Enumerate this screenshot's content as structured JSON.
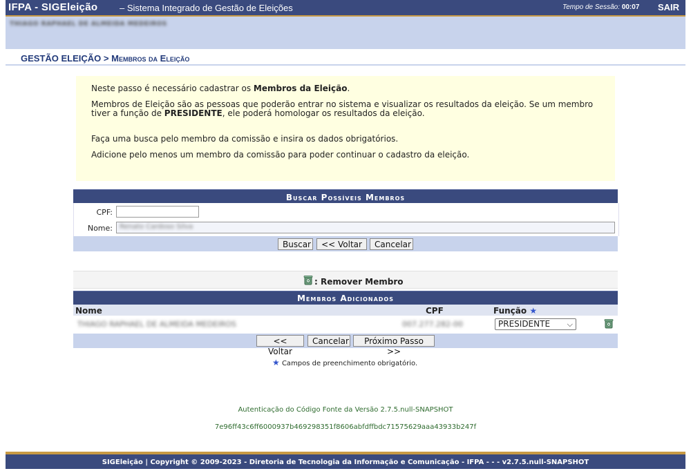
{
  "header": {
    "app_title": "IFPA - SIGEleição",
    "subtitle": "– Sistema Integrado de Gestão de Eleições",
    "session_label": "Tempo de Sessão:",
    "session_time": "00:07",
    "logout": "SAIR"
  },
  "user": {
    "name": "THIAGO RAPHAEL DE ALMEIDA MEDEIROS"
  },
  "breadcrumb": {
    "text": "Gestão Eleição > Membros da Eleição"
  },
  "info": {
    "p1_pre": "Neste passo é necessário cadastrar os ",
    "p1_bold": "Membros da Eleição",
    "p1_post": ".",
    "p2_pre": "Membros de Eleição são as pessoas que poderão entrar no sistema e visualizar os resultados da eleição. Se um membro tiver a função de ",
    "p2_bold": "PRESIDENTE",
    "p2_post": ", ele poderá homologar os resultados da eleição.",
    "p3": "Faça uma busca pelo membro da comissão e insira os dados obrigatórios.",
    "p4": "Adicione pelo menos um membro da comissão para poder continuar o cadastro da eleição."
  },
  "search": {
    "title": "Buscar Possíveis Membros",
    "cpf_label": "CPF:",
    "cpf_value": "",
    "name_label": "Nome:",
    "name_value": "Renato Cardoso Silva",
    "buttons": {
      "search": "Buscar",
      "back": "<< Voltar",
      "cancel": "Cancelar"
    }
  },
  "legend": {
    "remove": ": Remover Membro"
  },
  "members": {
    "title": "Membros Adicionados",
    "columns": {
      "name": "Nome",
      "cpf": "CPF",
      "role": "Função"
    },
    "rows": [
      {
        "name": "THIAGO RAPHAEL DE ALMEIDA MEDEIROS",
        "cpf": "007.277.282-00",
        "role": "PRESIDENTE"
      }
    ],
    "buttons": {
      "back": "<< Voltar",
      "cancel": "Cancelar",
      "next": "Próximo Passo >>"
    }
  },
  "required_note": "Campos de preenchimento obrigatório.",
  "auth": {
    "line1": "Autenticação do Código Fonte da Versão 2.7.5.null-SNAPSHOT",
    "hash": "7e96ff43c6ff6000937b469298351f8606abfdffbdc71575629aaa43933b247f"
  },
  "footer": {
    "text": "SIGEleição | Copyright © 2009-2023 - Diretoria de Tecnologia da Informação e Comunicação - IFPA - - - v2.7.5.null-SNAPSHOT"
  },
  "colors": {
    "header_bg": "#3a4a7e",
    "accent": "#c89a44",
    "panel_light": "#c8d3ec",
    "info_bg": "#ffffe1",
    "link_green": "#2e6b2e"
  }
}
